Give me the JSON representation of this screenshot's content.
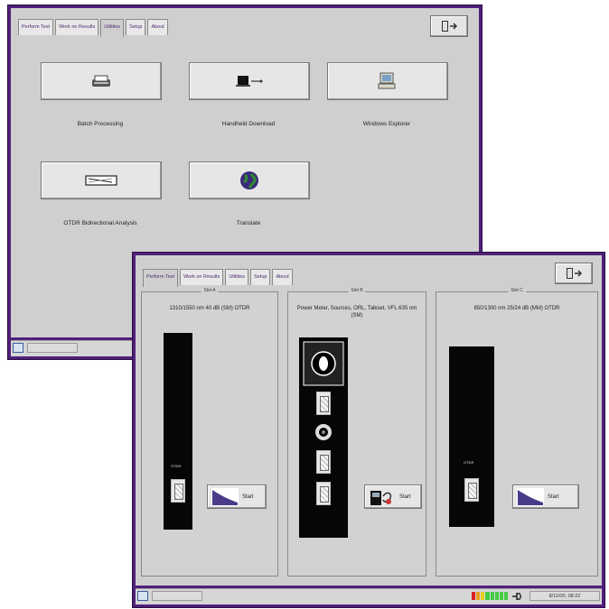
{
  "back_window": {
    "tabs": [
      "Perform Test",
      "Work on Results",
      "Utilities",
      "Setup",
      "About"
    ],
    "active_tab": "Utilities",
    "utilities": [
      {
        "label": "Batch Processing",
        "icon": "printer-icon"
      },
      {
        "label": "Handheld Download",
        "icon": "handheld-download-icon"
      },
      {
        "label": "Windows Explorer",
        "icon": "computer-icon"
      },
      {
        "label": "OTDR Bidirectional Analysis",
        "icon": "otdr-analysis-icon"
      },
      {
        "label": "Translate",
        "icon": "globe-icon"
      }
    ]
  },
  "front_window": {
    "tabs": [
      "Perform Test",
      "Work on Results",
      "Utilities",
      "Setup",
      "About"
    ],
    "active_tab": "Perform Test",
    "slots": [
      {
        "legend": "Slot A",
        "description": "1310/1550 nm 40 dB (SM) OTDR",
        "module_label": "OTDR",
        "button": "Start"
      },
      {
        "legend": "Slot B",
        "description": "Power Meter, Sources, ORL, Talkset, VFL 635 nm (SM)",
        "module_label": "",
        "button": "Start"
      },
      {
        "legend": "Slot C",
        "description": "850/1300 nm 25/24 dB (MM) OTDR",
        "module_label": "OTDR",
        "button": "Start"
      }
    ],
    "status": {
      "datetime": "8/11/00, 08:22"
    }
  },
  "colors": {
    "frame": "#50207a",
    "panel": "#cfcfcf",
    "tab_text": "#4a2a70"
  }
}
